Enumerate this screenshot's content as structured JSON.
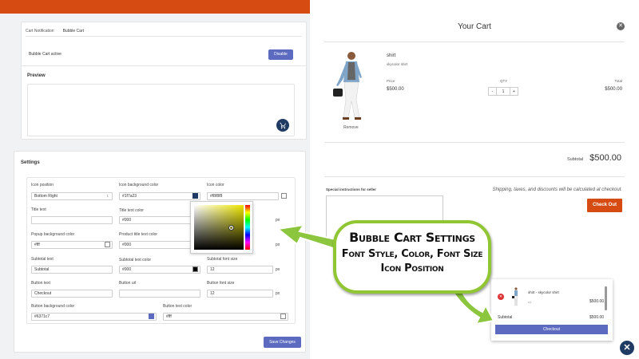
{
  "admin": {
    "tabs": [
      "Cart Notification",
      "Bubble Cart"
    ],
    "active_label": "Bubble Cart active",
    "disable_label": "Disable",
    "preview_label": "Preview",
    "settings_title": "Settings",
    "fields": {
      "icon_position": {
        "label": "Icon position",
        "value": "Bottom Right"
      },
      "icon_bg": {
        "label": "Icon background color",
        "value": "#1f7a23",
        "swatch": "#1f3b63"
      },
      "icon_color": {
        "label": "Icon color",
        "value": "#f8f8f8",
        "swatch": "#ffffff"
      },
      "title_text": {
        "label": "Title text",
        "value": ""
      },
      "title_text_color": {
        "label": "Title text color",
        "value": "#000"
      },
      "popup_bg": {
        "label": "Popup background color",
        "value": "#fff",
        "swatch": "#ffffff"
      },
      "product_title_color": {
        "label": "Product title text color",
        "value": "#000"
      },
      "subtotal_text": {
        "label": "Subtotal text",
        "value": "Subtotal"
      },
      "subtotal_text_color": {
        "label": "Subtotal text color",
        "value": "#000",
        "swatch": "#000000"
      },
      "subtotal_font_size": {
        "label": "Subtotal font size",
        "value": "12"
      },
      "button_text": {
        "label": "Button text",
        "value": "Checkout"
      },
      "button_url": {
        "label": "Button url",
        "value": ""
      },
      "button_font_size": {
        "label": "Button font size",
        "value": "12"
      },
      "button_bg": {
        "label": "Button background color",
        "value": "#6371c7",
        "swatch": "#5c6bc0"
      },
      "button_text_color": {
        "label": "Button text color",
        "value": "#fff",
        "swatch": "#ffffff"
      }
    },
    "px_unit": "px",
    "save_label": "Save Changes"
  },
  "cart": {
    "title": "Your Cart",
    "product_name": "shirt",
    "product_sub": "skycolor shirt",
    "remove_label": "Remove",
    "price_label": "Price",
    "qty_label": "QTY",
    "total_label": "Total",
    "price_value": "$500.00",
    "qty_value": "1",
    "qty_minus": "-",
    "qty_plus": "+",
    "total_value": "$500.00",
    "subtotal_label": "Subtotal",
    "subtotal_value": "$500.00",
    "special_label": "Special instructions for seller",
    "shipping_note": "Shipping, taxes, and discounts will be calculated at checkout.",
    "checkout_label": "Check Out"
  },
  "mini_cart": {
    "item_name": "shirt - skycolor shirt",
    "item_qty": "x1",
    "item_price": "$500.00",
    "subtotal_label": "Subtotal",
    "subtotal_value": "$500.00",
    "checkout_label": "Checkout"
  },
  "callout": {
    "line1": "Bubble Cart Settings",
    "line2": "Font Style, Color, Font Size",
    "line3": "Icon Position"
  },
  "colors": {
    "accent": "#5c6bc0",
    "brand": "#d64b12",
    "callout_border": "#90c633",
    "icon_dark": "#1f3b63"
  },
  "icons": [
    "cart-icon",
    "close-icon",
    "select-arrows-icon",
    "remove-item-icon"
  ]
}
